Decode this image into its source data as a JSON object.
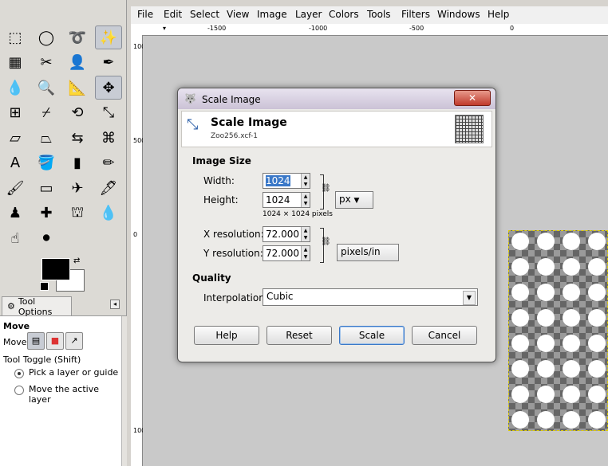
{
  "menubar": {
    "items": [
      "File",
      "Edit",
      "Select",
      "View",
      "Image",
      "Layer",
      "Colors",
      "Tools",
      "Filters",
      "Windows",
      "Help"
    ]
  },
  "rulers": {
    "top_ticks": [
      "-1500",
      "-1000",
      "-500",
      "0"
    ],
    "left_labels": [
      "100",
      "500",
      "0",
      "100"
    ]
  },
  "toolbox": {
    "tools": [
      {
        "name": "rect-select-icon",
        "glyph": "⬚"
      },
      {
        "name": "ellipse-select-icon",
        "glyph": "◯"
      },
      {
        "name": "free-select-icon",
        "glyph": "➰"
      },
      {
        "name": "fuzzy-select-icon",
        "glyph": "✨"
      },
      {
        "name": "select-by-color-icon",
        "glyph": "▦"
      },
      {
        "name": "scissors-icon",
        "glyph": "✂"
      },
      {
        "name": "foreground-select-icon",
        "glyph": "👤"
      },
      {
        "name": "paths-icon",
        "glyph": "✒"
      },
      {
        "name": "color-picker-icon",
        "glyph": "💧"
      },
      {
        "name": "zoom-icon",
        "glyph": "🔍"
      },
      {
        "name": "measure-icon",
        "glyph": "📐"
      },
      {
        "name": "move-icon",
        "glyph": "✥"
      },
      {
        "name": "align-icon",
        "glyph": "⊞"
      },
      {
        "name": "crop-icon",
        "glyph": "⌿"
      },
      {
        "name": "rotate-icon",
        "glyph": "⟲"
      },
      {
        "name": "scale-icon",
        "glyph": "⤡"
      },
      {
        "name": "shear-icon",
        "glyph": "▱"
      },
      {
        "name": "perspective-icon",
        "glyph": "⏢"
      },
      {
        "name": "flip-icon",
        "glyph": "⇆"
      },
      {
        "name": "cage-icon",
        "glyph": "⌘"
      },
      {
        "name": "text-icon",
        "glyph": "A"
      },
      {
        "name": "bucket-fill-icon",
        "glyph": "🪣"
      },
      {
        "name": "blend-icon",
        "glyph": "▮"
      },
      {
        "name": "pencil-icon",
        "glyph": "✏"
      },
      {
        "name": "paintbrush-icon",
        "glyph": "🖌"
      },
      {
        "name": "eraser-icon",
        "glyph": "▭"
      },
      {
        "name": "airbrush-icon",
        "glyph": "✈"
      },
      {
        "name": "ink-icon",
        "glyph": "🖋"
      },
      {
        "name": "clone-icon",
        "glyph": "♟"
      },
      {
        "name": "heal-icon",
        "glyph": "✚"
      },
      {
        "name": "perspective-clone-icon",
        "glyph": "⛫"
      },
      {
        "name": "blur-icon",
        "glyph": "💧"
      },
      {
        "name": "smudge-icon",
        "glyph": "☝"
      },
      {
        "name": "dodge-burn-icon",
        "glyph": "⚫"
      }
    ],
    "tool_options_tab": "Tool Options",
    "move_heading": "Move",
    "move_label": "Move:",
    "tool_toggle": "Tool Toggle  (Shift)",
    "radio_1": "Pick a layer or guide",
    "radio_2": "Move the active layer"
  },
  "dialog": {
    "window_title": "Scale Image",
    "close_glyph": "✕",
    "header_title": "Scale Image",
    "header_subtitle": "Zoo256.xcf-1",
    "image_size_heading": "Image Size",
    "width_label": "Width:",
    "width_value": "1024",
    "height_label": "Height:",
    "height_value": "1024",
    "size_note": "1024 × 1024 pixels",
    "size_unit": "px",
    "xres_label": "X resolution:",
    "xres_value": "72.000",
    "yres_label": "Y resolution:",
    "yres_value": "72.000",
    "res_unit": "pixels/in",
    "quality_heading": "Quality",
    "interp_label": "Interpolation:",
    "interp_value": "Cubic",
    "buttons": {
      "help": "Help",
      "reset": "Reset",
      "scale": "Scale",
      "cancel": "Cancel"
    }
  }
}
